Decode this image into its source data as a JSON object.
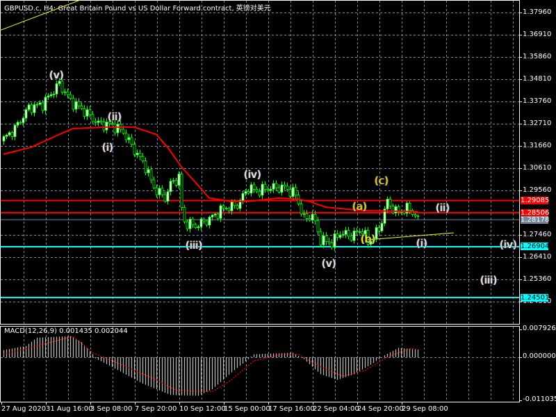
{
  "header": {
    "title": "GBPUSD.c, H4:  Great Britain Pound vs US Dollar Forward contract, 英镑对美元"
  },
  "colors": {
    "background": "#000000",
    "grid": "#778899",
    "candle": "#00ff00",
    "moving_average": "#ff0000",
    "support_line": "#00ffff",
    "resistance_line": "#ff0000",
    "trendline": "#ffff00",
    "macd_hist": "#c0c0c0",
    "macd_signal": "#ff0000"
  },
  "price_axis": {
    "ticks": [
      "1.37960",
      "1.36910",
      "1.35860",
      "1.34810",
      "1.33760",
      "1.32710",
      "1.31660",
      "1.30610",
      "1.29560",
      "1.27460",
      "1.26410",
      "1.25360",
      "1.24310"
    ]
  },
  "price_labels": [
    {
      "text": "1.29085",
      "value": 1.29085,
      "color": "#ff0000",
      "text_color": "#ffffff"
    },
    {
      "text": "1.28506",
      "value": 1.28506,
      "color": "#ff0000",
      "text_color": "#ffffff"
    },
    {
      "text": "1.28178",
      "value": 1.28178,
      "color": "#778899",
      "text_color": "#ffffff"
    },
    {
      "text": "1.26904",
      "value": 1.26904,
      "color": "#00ffff",
      "text_color": "#000000"
    },
    {
      "text": "1.24501",
      "value": 1.24501,
      "color": "#00ffff",
      "text_color": "#000000"
    }
  ],
  "time_axis": {
    "ticks": [
      "27 Aug 2020",
      "31 Aug 16:00",
      "3 Sep 08:00",
      "7 Sep 20:00",
      "10 Sep 12:00",
      "15 Sep 00:00",
      "17 Sep 16:00",
      "22 Sep 04:00",
      "24 Sep 20:00",
      "29 Sep 08:00"
    ]
  },
  "macd": {
    "title": "MACD(12,26,9) 0.001435 0.002044",
    "ticks": [
      "0.007926",
      "0.000000",
      "-0.011035"
    ]
  },
  "wave_labels": [
    {
      "text": "(v)",
      "color": "#ffffff",
      "bar": 19,
      "price": 1.3496
    },
    {
      "text": "(ii)",
      "color": "#ffffff",
      "bar": 40,
      "price": 1.33
    },
    {
      "text": "(i)",
      "color": "#ffffff",
      "bar": 38,
      "price": 1.3156
    },
    {
      "text": "(iv)",
      "color": "#ffffff",
      "bar": 89,
      "price": 1.3027
    },
    {
      "text": "(iii)",
      "color": "#ffffff",
      "bar": 68,
      "price": 1.2694
    },
    {
      "text": "(v)",
      "color": "#ffffff",
      "bar": 117,
      "price": 1.2609
    },
    {
      "text": "(a)",
      "color": "#ffd700",
      "bar": 128,
      "price": 1.2876
    },
    {
      "text": "(b)",
      "color": "#ffff00",
      "bar": 131,
      "price": 1.2722
    },
    {
      "text": "(c)",
      "color": "#ffd700",
      "bar": 136,
      "price": 1.2998
    },
    {
      "text": "(ii)",
      "color": "#ffffff",
      "bar": 158,
      "price": 1.287
    },
    {
      "text": "(i)",
      "color": "#ffffff",
      "bar": 151,
      "price": 1.2702
    },
    {
      "text": "(iv)",
      "color": "#ffffff",
      "bar": 181,
      "price": 1.2698
    },
    {
      "text": "(iii)",
      "color": "#ffffff",
      "bar": 174,
      "price": 1.2528
    }
  ],
  "chart_data": {
    "type": "candlestick",
    "symbol": "GBPUSD.c",
    "timeframe": "H4",
    "ylim": [
      1.24,
      1.3855
    ],
    "close_keypoints": [
      [
        0,
        1.3199
      ],
      [
        4,
        1.3248
      ],
      [
        9,
        1.3346
      ],
      [
        14,
        1.3363
      ],
      [
        20,
        1.3461
      ],
      [
        24,
        1.3379
      ],
      [
        29,
        1.333
      ],
      [
        34,
        1.3271
      ],
      [
        39,
        1.3264
      ],
      [
        43,
        1.3232
      ],
      [
        46,
        1.3166
      ],
      [
        51,
        1.3068
      ],
      [
        54,
        1.2969
      ],
      [
        58,
        1.292
      ],
      [
        60,
        1.2986
      ],
      [
        63,
        1.3018
      ],
      [
        64,
        1.2871
      ],
      [
        65,
        1.2805
      ],
      [
        69,
        1.2789
      ],
      [
        74,
        1.2821
      ],
      [
        79,
        1.2871
      ],
      [
        84,
        1.2887
      ],
      [
        88,
        1.2969
      ],
      [
        91,
        1.2953
      ],
      [
        96,
        1.2969
      ],
      [
        101,
        1.2969
      ],
      [
        105,
        1.2936
      ],
      [
        108,
        1.2821
      ],
      [
        111,
        1.2838
      ],
      [
        114,
        1.2723
      ],
      [
        118,
        1.2707
      ],
      [
        121,
        1.2756
      ],
      [
        125,
        1.274
      ],
      [
        129,
        1.2772
      ],
      [
        131,
        1.2707
      ],
      [
        135,
        1.2772
      ],
      [
        138,
        1.2904
      ],
      [
        141,
        1.2854
      ],
      [
        146,
        1.2871
      ],
      [
        149,
        1.2818
      ]
    ],
    "ma_keypoints": [
      [
        0,
        1.3127
      ],
      [
        10,
        1.316
      ],
      [
        20,
        1.322
      ],
      [
        25,
        1.3248
      ],
      [
        37,
        1.3255
      ],
      [
        47,
        1.3255
      ],
      [
        55,
        1.322
      ],
      [
        59,
        1.316
      ],
      [
        64,
        1.3068
      ],
      [
        70,
        1.298
      ],
      [
        74,
        1.292
      ],
      [
        82,
        1.2904
      ],
      [
        88,
        1.2904
      ],
      [
        99,
        1.292
      ],
      [
        106,
        1.2915
      ],
      [
        110,
        1.2904
      ],
      [
        116,
        1.2877
      ],
      [
        129,
        1.2861
      ],
      [
        149,
        1.2856
      ]
    ],
    "macd_hist_keypoints": [
      [
        0,
        0.0019
      ],
      [
        8,
        0.003
      ],
      [
        12,
        0.0052
      ],
      [
        24,
        0.0056
      ],
      [
        28,
        0.004
      ],
      [
        32,
        0.0008
      ],
      [
        33,
        -0.0003
      ],
      [
        40,
        -0.003
      ],
      [
        50,
        -0.007
      ],
      [
        60,
        -0.01
      ],
      [
        70,
        -0.0102
      ],
      [
        75,
        -0.0085
      ],
      [
        82,
        -0.004
      ],
      [
        88,
        -0.0005
      ],
      [
        90,
        0.0008
      ],
      [
        104,
        0.0012
      ],
      [
        108,
        -0.0005
      ],
      [
        114,
        -0.0045
      ],
      [
        120,
        -0.006
      ],
      [
        126,
        -0.0045
      ],
      [
        132,
        -0.002
      ],
      [
        137,
        0.0005
      ],
      [
        142,
        0.0025
      ],
      [
        149,
        0.002
      ]
    ],
    "macd_signal_keypoints": [
      [
        0,
        0.0008
      ],
      [
        12,
        0.003
      ],
      [
        25,
        0.0055
      ],
      [
        32,
        0.0012
      ],
      [
        40,
        -0.0012
      ],
      [
        55,
        -0.006
      ],
      [
        62,
        -0.0087
      ],
      [
        70,
        -0.009
      ],
      [
        75,
        -0.0092
      ],
      [
        82,
        -0.006
      ],
      [
        90,
        -0.001
      ],
      [
        100,
        0.0008
      ],
      [
        106,
        0.0008
      ],
      [
        114,
        -0.0025
      ],
      [
        122,
        -0.005
      ],
      [
        130,
        -0.0035
      ],
      [
        138,
        0.0
      ],
      [
        146,
        0.0023
      ],
      [
        149,
        0.0022
      ]
    ],
    "horizontal_lines": [
      1.29085,
      1.28506,
      1.26904,
      1.24501
    ],
    "trendlines": [
      {
        "from": [
          -1,
          1.3713
        ],
        "to": [
          28,
          1.3857
        ],
        "color": "#ffff00"
      },
      {
        "from": [
          131,
          1.2723
        ],
        "to": [
          162,
          1.2756
        ],
        "color": "#ffff00"
      }
    ]
  }
}
